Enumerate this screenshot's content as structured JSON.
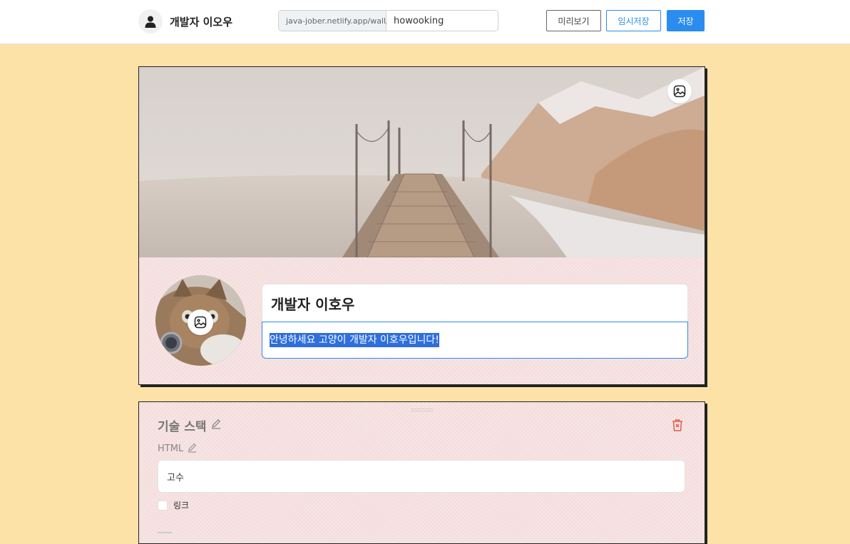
{
  "header": {
    "profile_name": "개발자 이오우",
    "url_prefix": "java-jober.netlify.app/wall/",
    "url_slug": "howooking",
    "preview_label": "미리보기",
    "draft_label": "임시저장",
    "save_label": "저장"
  },
  "profile": {
    "name": "개발자 이호우",
    "intro": "안녕하세요 고양이 개발자 이호우입니다!"
  },
  "stack_section": {
    "title": "기술 스택",
    "skill_name": "HTML",
    "skill_level": "고수",
    "link_label": "링크"
  },
  "colors": {
    "page_background": "#fde2a7",
    "card_background": "#f7e1e1",
    "accent": "#2b8cf0",
    "delete": "#e05a4f"
  },
  "icons": {
    "header_avatar": "user-icon",
    "clear": "clear-icon",
    "cover_change": "image-edit-icon",
    "photo_change": "image-edit-icon",
    "title_edit": "pencil-icon",
    "skill_edit": "pencil-icon",
    "delete": "trash-icon"
  }
}
